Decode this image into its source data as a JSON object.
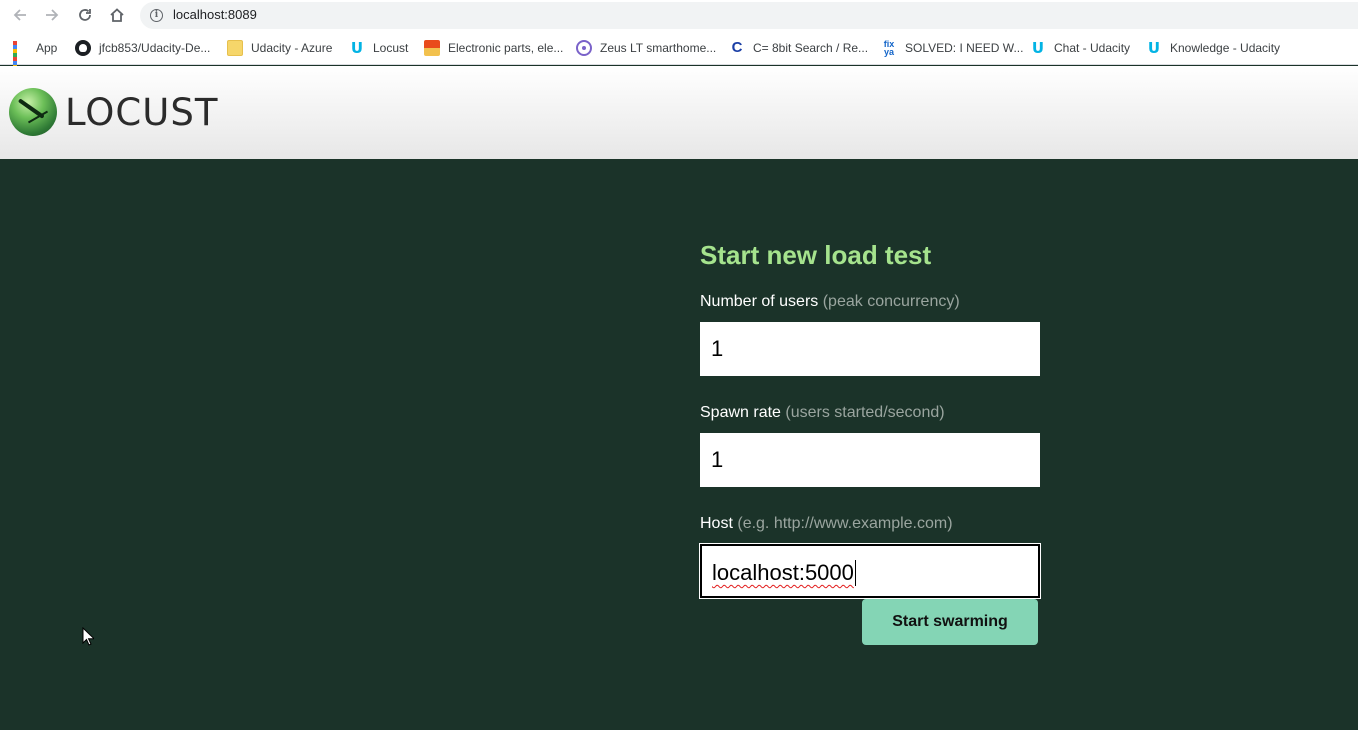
{
  "browser": {
    "url": "localhost:8089",
    "bookmarks": [
      {
        "label": "App",
        "icon": "apps-grid-icon"
      },
      {
        "label": "jfcb853/Udacity-De...",
        "icon": "github-icon"
      },
      {
        "label": "Udacity - Azure",
        "icon": "folder-icon"
      },
      {
        "label": "Locust",
        "icon": "udacity-icon"
      },
      {
        "label": "Electronic parts, ele...",
        "icon": "electronics-icon"
      },
      {
        "label": "Zeus LT smarthome...",
        "icon": "atom-icon"
      },
      {
        "label": "C= 8bit Search / Re...",
        "icon": "commodore-icon"
      },
      {
        "label": "SOLVED: I NEED W...",
        "icon": "fixya-icon"
      },
      {
        "label": "Chat - Udacity",
        "icon": "udacity-icon"
      },
      {
        "label": "Knowledge - Udacity",
        "icon": "udacity-icon"
      }
    ]
  },
  "header": {
    "logo_text": "LOCUST"
  },
  "form": {
    "title": "Start new load test",
    "users": {
      "label": "Number of users",
      "hint": "(peak concurrency)",
      "value": "1"
    },
    "spawn": {
      "label": "Spawn rate",
      "hint": "(users started/second)",
      "value": "1"
    },
    "host": {
      "label": "Host",
      "hint": "(e.g. http://www.example.com)",
      "value": "localhost:5000"
    },
    "submit_label": "Start swarming"
  },
  "colors": {
    "page_bg": "#1b3329",
    "title": "#a5e38d",
    "button": "#84d5b5"
  }
}
